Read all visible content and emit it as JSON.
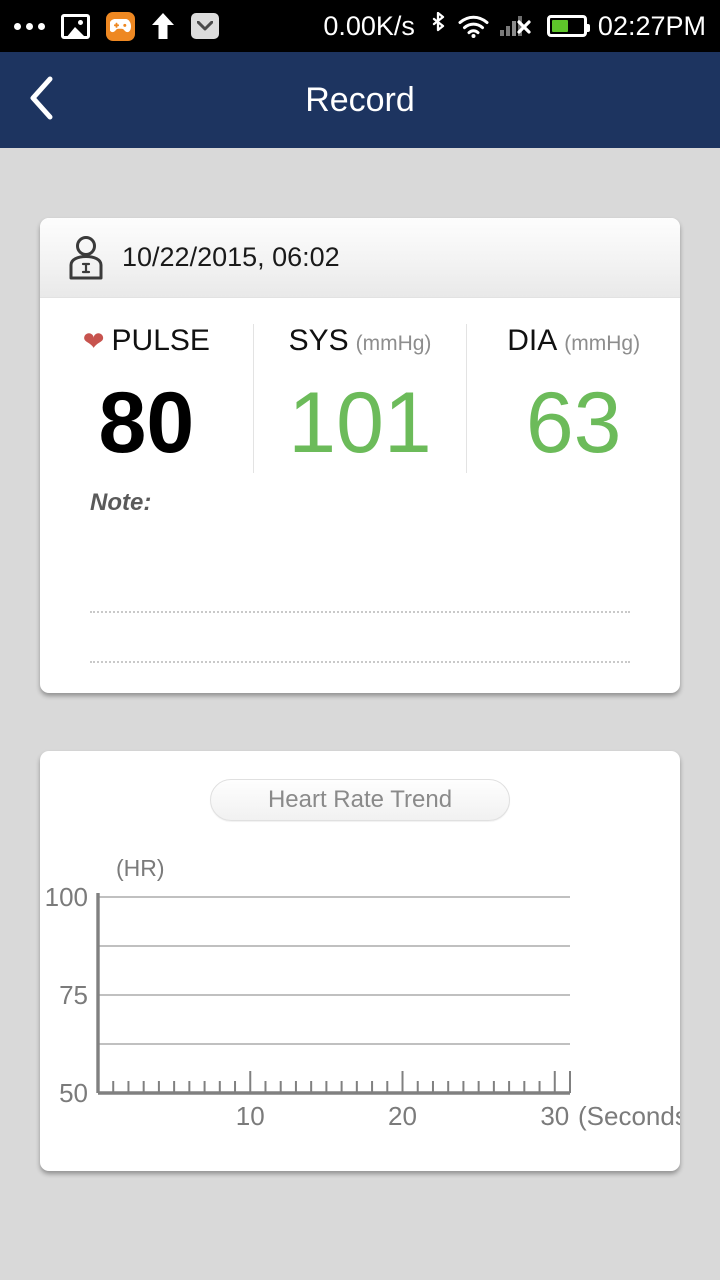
{
  "statusbar": {
    "net_speed": "0.00K/s",
    "time": "02:27PM",
    "battery_level": 55,
    "icons": [
      "ellipsis-icon",
      "photo-icon",
      "game-controller-icon",
      "upload-arrow-icon",
      "mail-icon",
      "bluetooth-icon",
      "wifi-icon",
      "signal-no-sim-icon",
      "battery-icon"
    ]
  },
  "navbar": {
    "title": "Record",
    "back_icon": "chevron-left-icon"
  },
  "record": {
    "user_icon": "person-icon",
    "date": "10/22/2015, 06:02",
    "vitals": [
      {
        "label": "PULSE",
        "unit": "",
        "value": "80",
        "icon": "heart-icon",
        "color": "#000000"
      },
      {
        "label": "SYS",
        "unit": "(mmHg)",
        "value": "101",
        "icon": "",
        "color": "#6cbb5a"
      },
      {
        "label": "DIA",
        "unit": "(mmHg)",
        "value": "63",
        "icon": "",
        "color": "#6cbb5a"
      }
    ],
    "note_label": "Note:",
    "note_lines": [
      "",
      ""
    ]
  },
  "chart_card": {
    "title": "Heart Rate Trend"
  },
  "chart_data": {
    "type": "line",
    "title": "Heart Rate Trend",
    "xlabel": "(Seconds)",
    "ylabel": "(HR)",
    "xlim": [
      0,
      31
    ],
    "ylim": [
      50,
      100
    ],
    "ytick_labels": [
      "100",
      "75",
      "50"
    ],
    "yticks": [
      100,
      75,
      50
    ],
    "gridlines_y": [
      87.5,
      75,
      62.5
    ],
    "xtick_labels": [
      "10",
      "20",
      "30"
    ],
    "xticks": [
      10,
      20,
      30
    ],
    "xtick_step": 1,
    "grid": true,
    "legend": "none",
    "series": [
      {
        "name": "Heart Rate",
        "x": [],
        "values": []
      }
    ],
    "axis_color": "#808080",
    "grid_color": "#9a9a9a"
  }
}
